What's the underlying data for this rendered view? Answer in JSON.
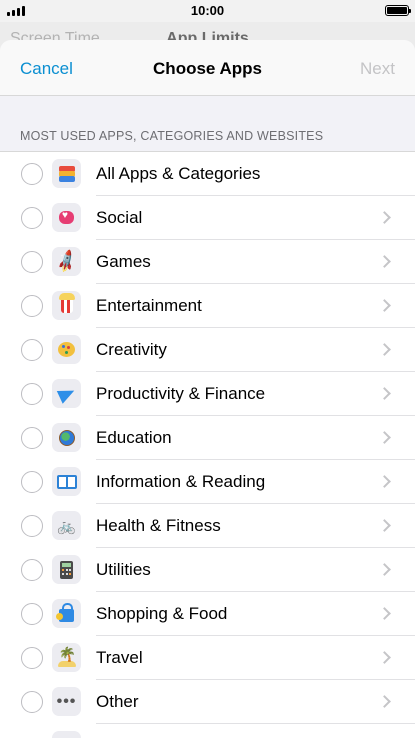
{
  "status_bar": {
    "time": "10:00"
  },
  "behind": {
    "back_label": "Screen Time",
    "title": "App Limits"
  },
  "nav": {
    "cancel": "Cancel",
    "title": "Choose Apps",
    "next": "Next"
  },
  "section_header": "MOST USED APPS, CATEGORIES AND WEBSITES",
  "rows": [
    {
      "label": "All Apps & Categories",
      "icon": "layers-stack-icon",
      "chevron": false
    },
    {
      "label": "Social",
      "icon": "speech-bubble-heart-icon",
      "chevron": true
    },
    {
      "label": "Games",
      "icon": "rocket-icon",
      "chevron": true
    },
    {
      "label": "Entertainment",
      "icon": "popcorn-icon",
      "chevron": true
    },
    {
      "label": "Creativity",
      "icon": "paint-palette-icon",
      "chevron": true
    },
    {
      "label": "Productivity & Finance",
      "icon": "paper-plane-icon",
      "chevron": true
    },
    {
      "label": "Education",
      "icon": "globe-icon",
      "chevron": true
    },
    {
      "label": "Information & Reading",
      "icon": "open-book-icon",
      "chevron": true
    },
    {
      "label": "Health & Fitness",
      "icon": "bicycle-icon",
      "chevron": true
    },
    {
      "label": "Utilities",
      "icon": "calculator-icon",
      "chevron": true
    },
    {
      "label": "Shopping & Food",
      "icon": "shopping-bag-icon",
      "chevron": true
    },
    {
      "label": "Travel",
      "icon": "palm-tree-beach-icon",
      "chevron": true
    },
    {
      "label": "Other",
      "icon": "more-dots-icon",
      "chevron": true
    }
  ],
  "colors": {
    "accent": "#0b8fd1",
    "disabled": "#c4c4c6",
    "background": "#f2f2f7"
  }
}
